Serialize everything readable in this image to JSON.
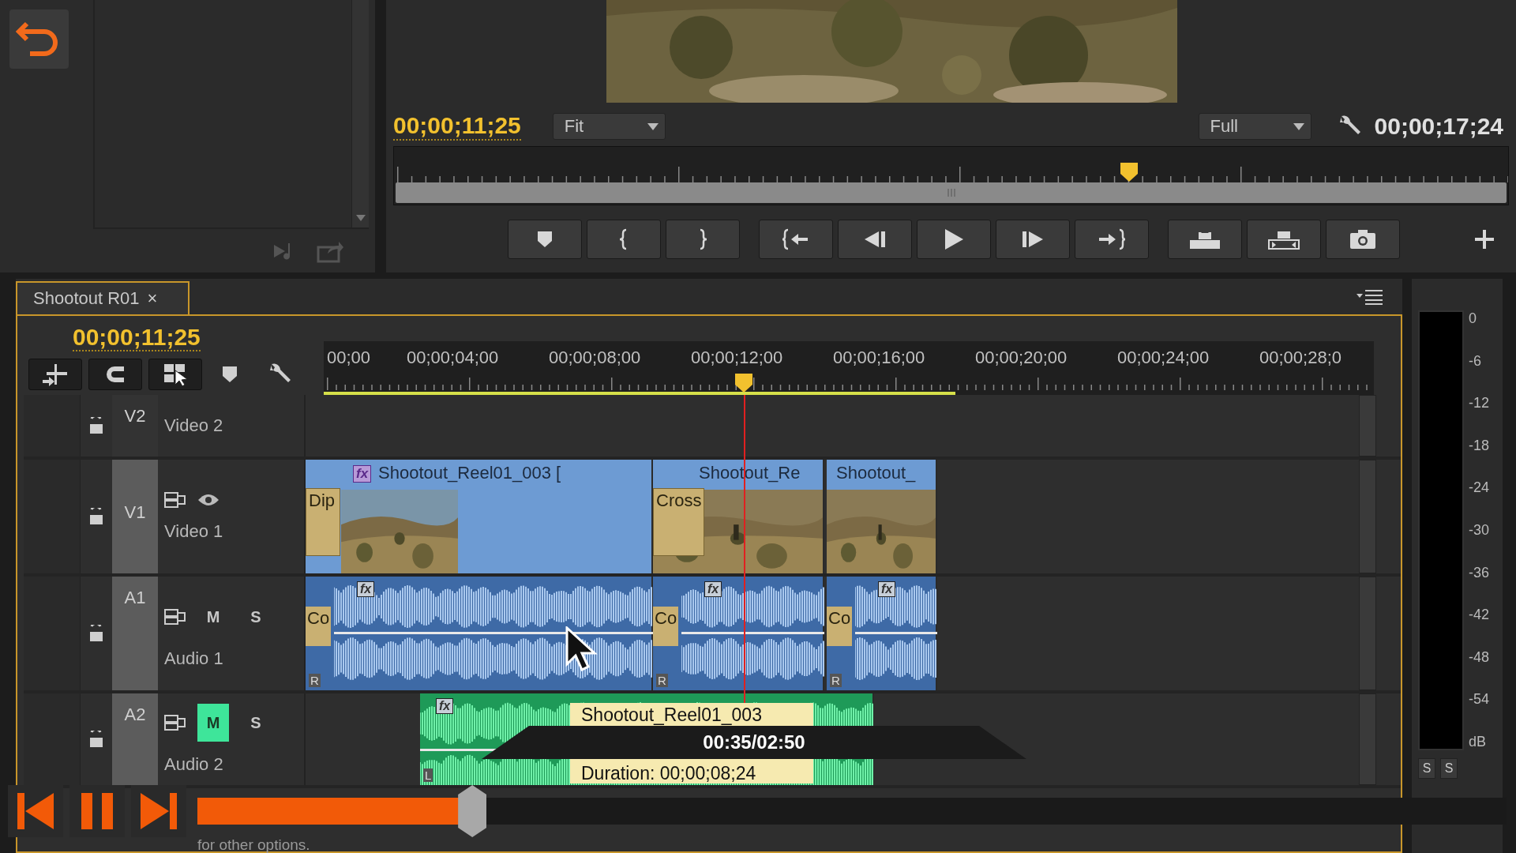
{
  "program_monitor": {
    "current_time": "00;00;11;25",
    "zoom": "Fit",
    "quality": "Full",
    "duration": "00;00;17;24",
    "playhead": {
      "level": 0.66
    },
    "buttons": [
      {
        "kind": "marker"
      },
      {
        "kind": "mark-in"
      },
      {
        "kind": "mark-out"
      },
      {
        "kind": "go-to-in"
      },
      {
        "kind": "step-back"
      },
      {
        "kind": "play"
      },
      {
        "kind": "step-forward"
      },
      {
        "kind": "go-to-out"
      },
      {
        "kind": "lift"
      },
      {
        "kind": "extract"
      },
      {
        "kind": "export-frame"
      },
      {
        "kind": "add"
      }
    ]
  },
  "timeline": {
    "tab": "Shootout R01",
    "tab_close": "×",
    "current_time": "00;00;11;25",
    "tools": [
      {
        "kind": "insert"
      },
      {
        "kind": "snap"
      },
      {
        "kind": "linked"
      },
      {
        "kind": "marker"
      },
      {
        "kind": "settings"
      }
    ],
    "ruler": [
      "00;00",
      "00;00;04;00",
      "00;00;08;00",
      "00;00;12;00",
      "00;00;16;00",
      "00;00;20;00",
      "00;00;24;00",
      "00;00;28;0"
    ],
    "playhead": {
      "level": 0.4
    },
    "tracks": [
      {
        "kind": "video",
        "code": "V2",
        "name": "Video 2",
        "targeted": false,
        "toggles": false
      },
      {
        "kind": "video",
        "code": "V1",
        "name": "Video 1",
        "targeted": true,
        "toggles": true,
        "clips": [
          {
            "name": "Shootout_Reel01_003 [",
            "fx": "fx",
            "transition": "Dip"
          },
          {
            "name": "Shootout_Re",
            "transition": "Cross"
          },
          {
            "name": "Shootout_"
          }
        ]
      },
      {
        "kind": "audio",
        "code": "A1",
        "name": "Audio 1",
        "targeted": true,
        "mute": "M",
        "solo": "S",
        "muted": false,
        "clips": [
          {
            "fx": "fx",
            "transition": "Co",
            "channel": "R"
          },
          {
            "fx": "fx",
            "transition": "Co",
            "channel": "R"
          },
          {
            "fx": "fx",
            "transition": "Co",
            "channel": "R"
          }
        ]
      },
      {
        "kind": "audio",
        "code": "A2",
        "name": "Audio 2",
        "targeted": true,
        "mute": "M",
        "solo": "S",
        "muted": true,
        "clips": [
          {
            "fx": "fx",
            "channel": "L"
          }
        ]
      }
    ]
  },
  "clip_tooltip": {
    "name": "Shootout_Reel01_003",
    "duration": "Duration: 00;00;08;24"
  },
  "meter": {
    "scale": [
      "0",
      "-6",
      "-12",
      "-18",
      "-24",
      "-30",
      "-36",
      "-42",
      "-48",
      "-54"
    ],
    "unit": "dB",
    "solo": [
      "S",
      "S"
    ]
  },
  "status_text": "for other options.",
  "player": {
    "time": "00:35/02:50",
    "level": 0.21
  }
}
